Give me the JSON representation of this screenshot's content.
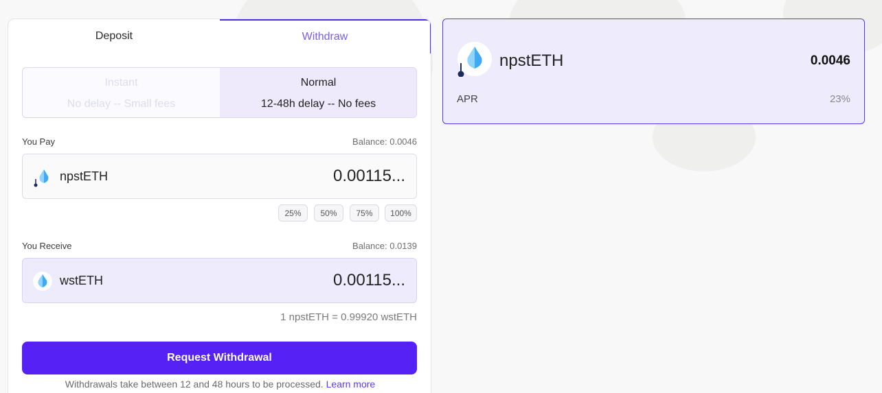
{
  "tabs": {
    "deposit": "Deposit",
    "withdraw": "Withdraw"
  },
  "modes": {
    "instant": {
      "title": "Instant",
      "subtitle": "No delay -- Small fees"
    },
    "normal": {
      "title": "Normal",
      "subtitle": "12-48h delay -- No fees"
    }
  },
  "pay": {
    "label": "You Pay",
    "balance": "Balance: 0.0046",
    "token": "npstETH",
    "amount": "0.00115..."
  },
  "percent_buttons": [
    "25%",
    "50%",
    "75%",
    "100%"
  ],
  "receive": {
    "label": "You Receive",
    "balance": "Balance: 0.0139",
    "token": "wstETH",
    "amount": "0.00115..."
  },
  "rate": "1 npstETH = 0.99920 wstETH",
  "submit_label": "Request Withdrawal",
  "note": {
    "text": "Withdrawals take between 12 and 48 hours to be processed.",
    "link": "Learn more"
  },
  "position": {
    "token": "npstETH",
    "value": "0.0046",
    "apr_label": "APR",
    "apr_value": "23%"
  },
  "colors": {
    "accent": "#5521f5",
    "selected_bg": "#eeebfc",
    "link": "#5a3bf0"
  }
}
